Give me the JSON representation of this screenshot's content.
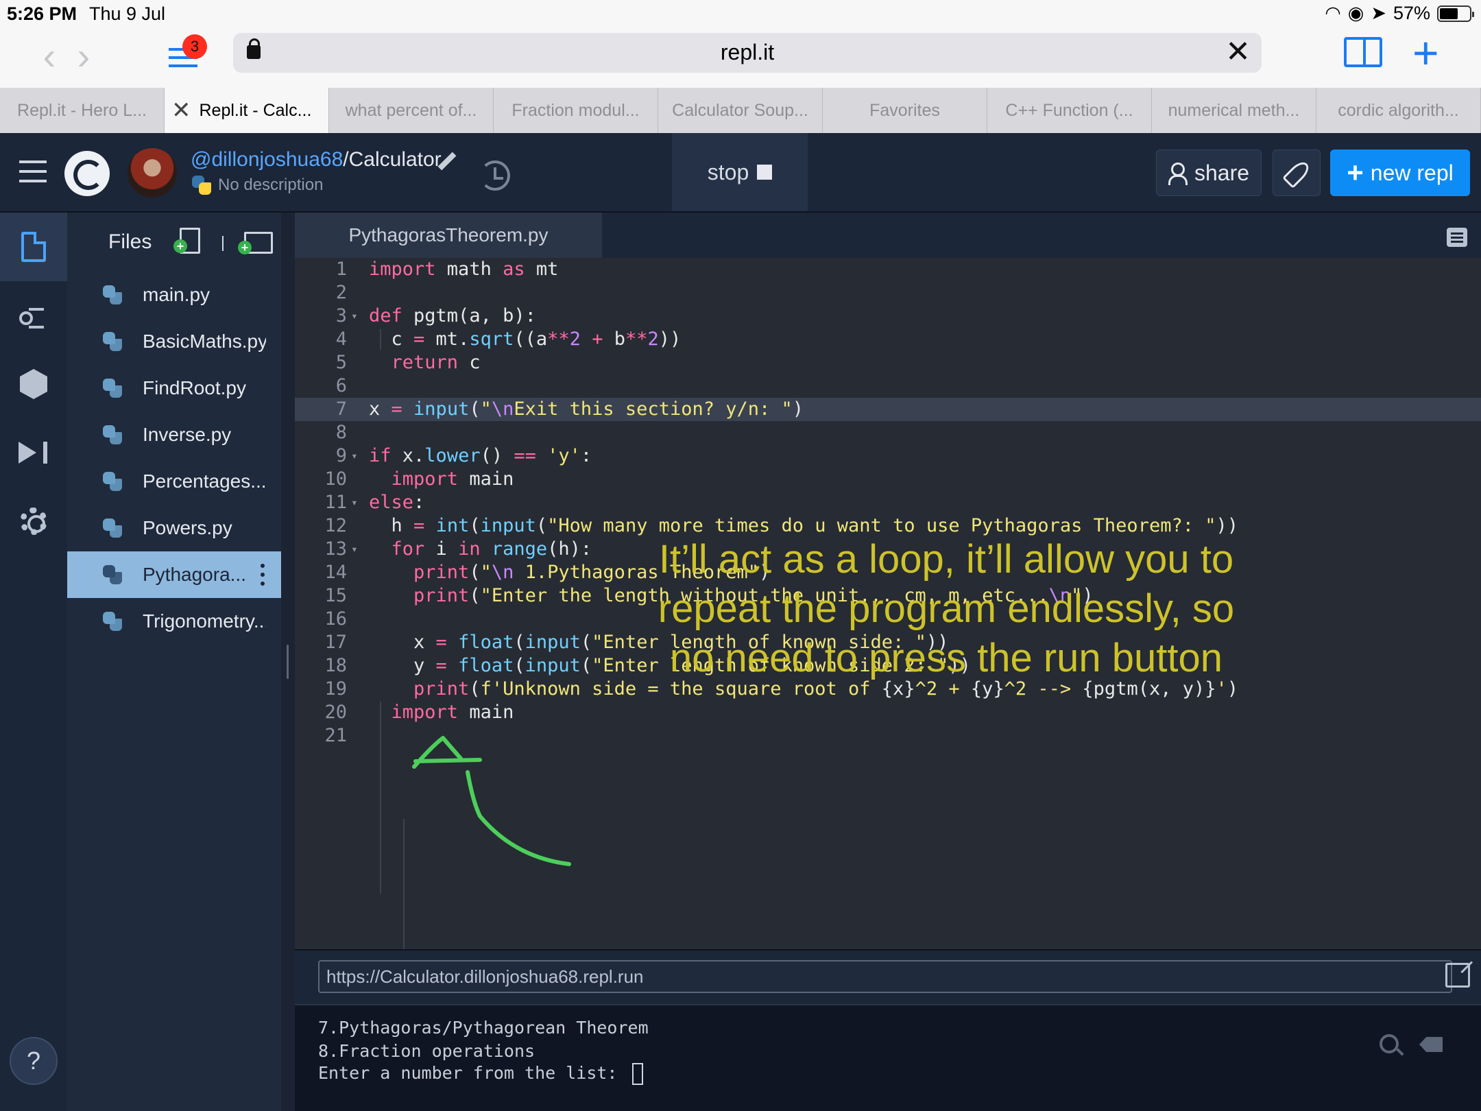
{
  "status_bar": {
    "time": "5:26 PM",
    "date": "Thu 9 Jul",
    "battery": "57%"
  },
  "safari": {
    "url": "repl.it",
    "tab_badge": "3",
    "tabs": [
      "Repl.it - Hero L...",
      "Repl.it - Calc...",
      "what percent of...",
      "Fraction modul...",
      "Calculator Soup...",
      "Favorites",
      "C++ Function (...",
      "numerical meth...",
      "cordic algorith..."
    ]
  },
  "repl": {
    "user": "@dillonjoshua68",
    "name": "/Calculator",
    "description": "No description",
    "stop_label": "stop",
    "share_label": "share",
    "new_repl_label": "new repl"
  },
  "files_panel": {
    "title": "Files",
    "files": [
      "main.py",
      "BasicMaths.py",
      "FindRoot.py",
      "Inverse.py",
      "Percentages....",
      "Powers.py",
      "Pythagora...",
      "Trigonometry..."
    ]
  },
  "editor": {
    "tab": "PythagorasTheorem.py",
    "line_numbers": [
      "1",
      "2",
      "3",
      "4",
      "5",
      "6",
      "7",
      "8",
      "9",
      "10",
      "11",
      "12",
      "13",
      "14",
      "15",
      "16",
      "17",
      "18",
      "19",
      "20",
      "21"
    ]
  },
  "annotation": {
    "lines": [
      "It’ll act as a loop, it’ll allow you to",
      "repeat the program endlessly, so",
      "no need to press the run button"
    ]
  },
  "webview": {
    "url": "https://Calculator.dillonjoshua68.repl.run"
  },
  "console": {
    "lines": [
      "7.Pythagoras/Pythagorean Theorem",
      "8.Fraction operations",
      "Enter a number from the list: "
    ]
  },
  "colors": {
    "accent": "#0d8cf5",
    "annotation": "#cdc32a",
    "arrow": "#4ccf5a"
  }
}
